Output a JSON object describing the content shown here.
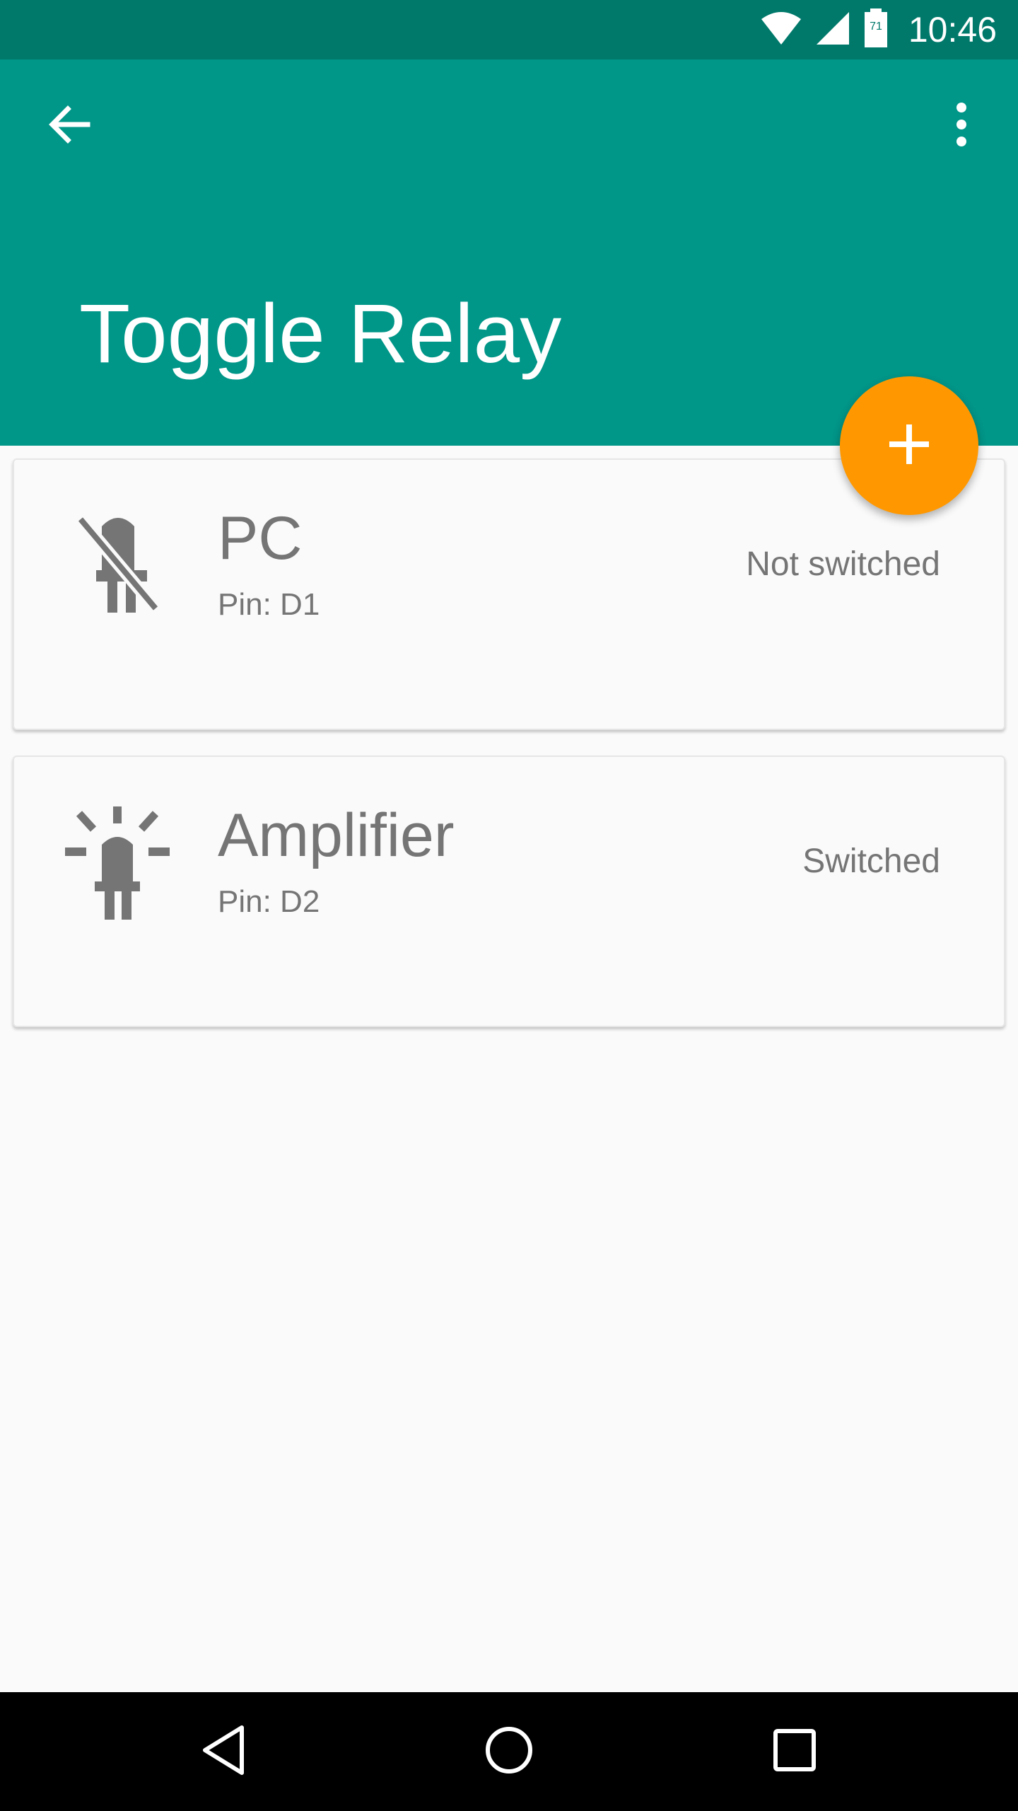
{
  "status_bar": {
    "time": "10:46",
    "battery_level": "71",
    "icons": [
      "wifi-icon",
      "cell-signal-icon",
      "battery-icon"
    ]
  },
  "app_bar": {
    "title": "Toggle Relay",
    "back_icon": "arrow-back-icon",
    "menu_icon": "more-vert-icon",
    "color": "#009688"
  },
  "relays": [
    {
      "name": "PC",
      "pin": "Pin: D1",
      "status": "Not switched",
      "icon": "led-off-icon"
    },
    {
      "name": "Amplifier",
      "pin": "Pin: D2",
      "status": "Switched",
      "icon": "led-on-icon"
    }
  ],
  "fab": {
    "icon": "add-icon",
    "color": "#FF9800"
  },
  "nav_bar": {
    "icons": [
      "nav-back-icon",
      "nav-home-icon",
      "nav-recents-icon"
    ]
  }
}
